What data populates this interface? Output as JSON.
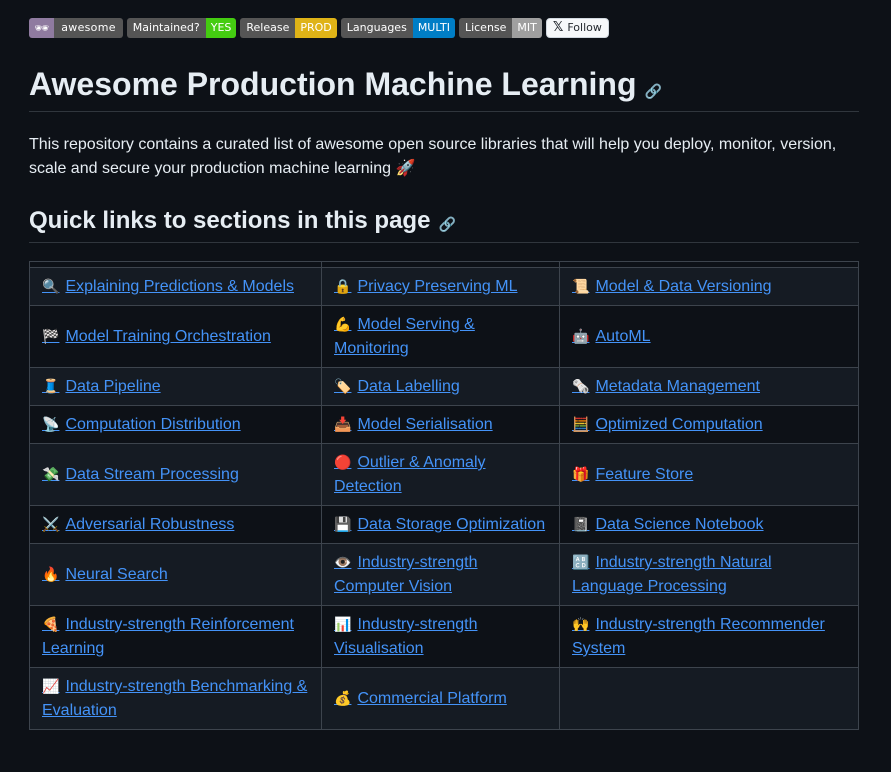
{
  "badges": [
    {
      "label": "🕶",
      "value": "awesome",
      "style": "awesome"
    },
    {
      "label": "Maintained?",
      "value": "YES",
      "color": "#4c1"
    },
    {
      "label": "Release",
      "value": "PROD",
      "color": "#dfb317"
    },
    {
      "label": "Languages",
      "value": "MULTI",
      "color": "#007ec6"
    },
    {
      "label": "License",
      "value": "MIT",
      "color": "#9f9f9f"
    }
  ],
  "follow": {
    "icon": "x-logo-icon",
    "label": "Follow"
  },
  "title": "Awesome Production Machine Learning",
  "intro": "This repository contains a curated list of awesome open source libraries that will help you deploy, monitor, version, scale and secure your production machine learning 🚀",
  "quick_links_heading": "Quick links to sections in this page",
  "sections": [
    [
      {
        "icon": "🔍",
        "label": "Explaining Predictions & Models"
      },
      {
        "icon": "🔒",
        "label": "Privacy Preserving ML"
      },
      {
        "icon": "📜",
        "label": "Model & Data Versioning"
      }
    ],
    [
      {
        "icon": "🏁",
        "label": "Model Training Orchestration"
      },
      {
        "icon": "💪",
        "label": "Model Serving & Monitoring"
      },
      {
        "icon": "🤖",
        "label": "AutoML"
      }
    ],
    [
      {
        "icon": "🧵",
        "label": "Data Pipeline"
      },
      {
        "icon": "🏷️",
        "label": "Data Labelling"
      },
      {
        "icon": "🗞️",
        "label": "Metadata Management"
      }
    ],
    [
      {
        "icon": "📡",
        "label": "Computation Distribution"
      },
      {
        "icon": "📥",
        "label": "Model Serialisation"
      },
      {
        "icon": "🧮",
        "label": "Optimized Computation"
      }
    ],
    [
      {
        "icon": "💸",
        "label": "Data Stream Processing"
      },
      {
        "icon": "🔴",
        "label": "Outlier & Anomaly Detection"
      },
      {
        "icon": "🎁",
        "label": "Feature Store"
      }
    ],
    [
      {
        "icon": "⚔️",
        "label": "Adversarial Robustness"
      },
      {
        "icon": "💾",
        "label": "Data Storage Optimization"
      },
      {
        "icon": "📓",
        "label": "Data Science Notebook"
      }
    ],
    [
      {
        "icon": "🔥",
        "label": "Neural Search"
      },
      {
        "icon": "👁️",
        "label": "Industry-strength Computer Vision"
      },
      {
        "icon": "🔠",
        "label": "Industry-strength Natural Language Processing"
      }
    ],
    [
      {
        "icon": "🍕",
        "label": "Industry-strength Reinforcement Learning"
      },
      {
        "icon": "📊",
        "label": "Industry-strength Visualisation"
      },
      {
        "icon": "🙌",
        "label": "Industry-strength Recommender System"
      }
    ],
    [
      {
        "icon": "📈",
        "label": "Industry-strength Benchmarking & Evaluation"
      },
      {
        "icon": "💰",
        "label": "Commercial Platform"
      },
      null
    ]
  ]
}
